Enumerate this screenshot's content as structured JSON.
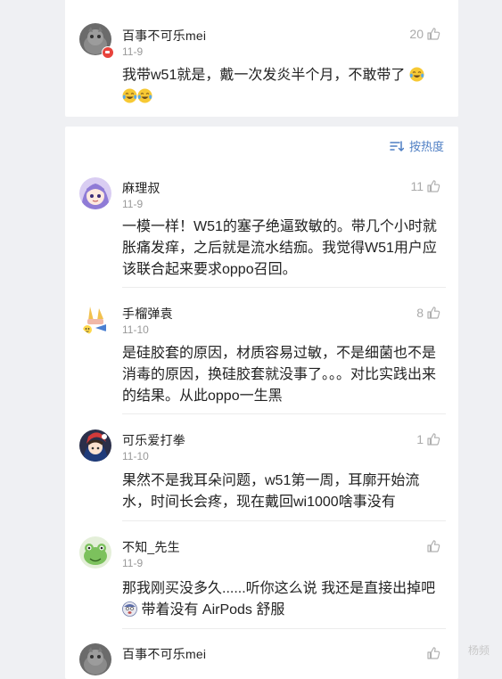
{
  "pinned_comment": {
    "username": "百事不可乐mei",
    "date": "11-9",
    "likes": "20",
    "text": "我带w51就是，戴一次发炎半个月，不敢带了",
    "emoji_name": "laughing-crying-emoji"
  },
  "sort_label": "按热度",
  "comments": [
    {
      "username": "麻理叔",
      "date": "11-9",
      "likes": "11",
      "text": "一模一样！W51的塞子绝逼致敏的。带几个小时就胀痛发痒，之后就是流水结痂。我觉得W51用户应该联合起来要求oppo召回。"
    },
    {
      "username": "手榴弹袁",
      "date": "11-10",
      "likes": "8",
      "text": "是硅胶套的原因，材质容易过敏，不是细菌也不是消毒的原因，换硅胶套就没事了。。。对比实践出来的结果。从此oppo一生黑"
    },
    {
      "username": "可乐爱打拳",
      "date": "11-10",
      "likes": "1",
      "text": "果然不是我耳朵问题，w51第一周，耳廓开始流水，时间长会疼，现在戴回wi1000啥事没有"
    },
    {
      "username": "不知_先生",
      "date": "11-9",
      "likes": "",
      "text_line1": "那我刚买没多久......听你这么说 我还是直接出掉吧",
      "text_line2": "带着没有 AirPods 舒服"
    },
    {
      "username": "百事不可乐mei",
      "date": "",
      "likes": ""
    }
  ],
  "watermark": "杨频",
  "colors": {
    "page_bg": "#eff0f3",
    "card_bg": "#ffffff",
    "accent_blue": "#4f7fc4",
    "muted_text": "#999999",
    "badge_red": "#e8433c"
  }
}
